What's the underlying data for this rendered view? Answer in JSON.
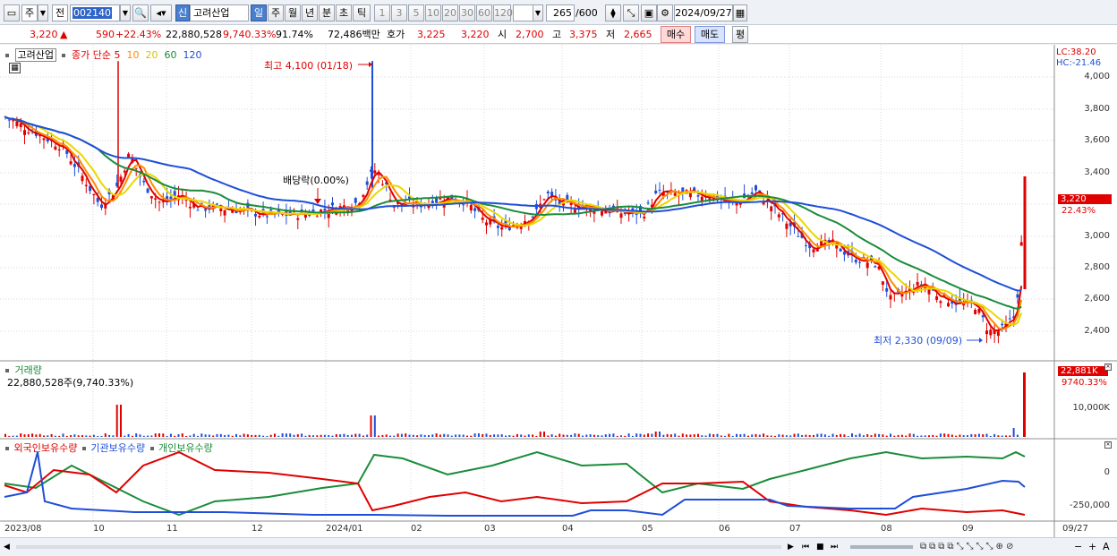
{
  "toolbar": {
    "mode_label": "주",
    "prev_label": "전",
    "code": "002140",
    "badge": "신",
    "name": "고려산업",
    "periods": [
      "일",
      "주",
      "월",
      "년",
      "분",
      "초",
      "틱"
    ],
    "active_period": "일",
    "intervals": [
      "1",
      "3",
      "5",
      "10",
      "20",
      "30",
      "60",
      "120"
    ],
    "count": "265",
    "total": "/600",
    "date": "2024/09/27"
  },
  "info": {
    "price": "3,220",
    "arrow": "▲",
    "change": "590",
    "change_pct": "+22.43%",
    "volume": "22,880,528",
    "volume_pct": "9,740.33%",
    "ratio": "91.74%",
    "amount": "72,486백만",
    "quote_label": "호가",
    "ask": "3,225",
    "bid": "3,220",
    "open_label": "시",
    "open": "2,700",
    "high_label": "고",
    "high": "3,375",
    "low_label": "저",
    "low": "2,665",
    "buy_label": "매수",
    "sell_label": "매도",
    "eval_label": "평"
  },
  "legend": {
    "name": "고려산업",
    "ma_label": "종가 단순",
    "ma_periods": [
      "5",
      "10",
      "20",
      "60",
      "120"
    ],
    "ma_colors": [
      "#e00000",
      "#ff8c00",
      "#e8d800",
      "#1a8c3a",
      "#1f4fd8"
    ]
  },
  "annotations": {
    "high_note": "최고 4,100 (01/18)",
    "low_note": "최저 2,330 (09/09)",
    "dividend_note": "배당락(0.00%)"
  },
  "right_axis": {
    "lc": "LC:38.20",
    "hc": "HC:-21.46",
    "price_labels": [
      "4,000",
      "3,800",
      "3,600",
      "3,400",
      "3,200",
      "3,000",
      "2,800",
      "2,600",
      "2,400"
    ],
    "price_tag": "3,220",
    "price_tag_pct": "22.43%",
    "vol_tag": "22,881K",
    "vol_tag_pct": "9740.33%",
    "vol_label": "10,000K",
    "holding_labels": [
      "0",
      "-250,000"
    ]
  },
  "volume_panel": {
    "title": "거래량",
    "value": "22,880,528주(9,740.33%)"
  },
  "holding_panel": {
    "series": [
      "외국인보유수량",
      "기관보유수량",
      "개인보유수량"
    ],
    "colors": [
      "#e00000",
      "#1f4fd8",
      "#1a8c3a"
    ]
  },
  "x_axis": [
    "2023/08",
    "10",
    "11",
    "12",
    "2024/01",
    "02",
    "03",
    "04",
    "05",
    "06",
    "07",
    "08",
    "09",
    "09/27"
  ]
}
